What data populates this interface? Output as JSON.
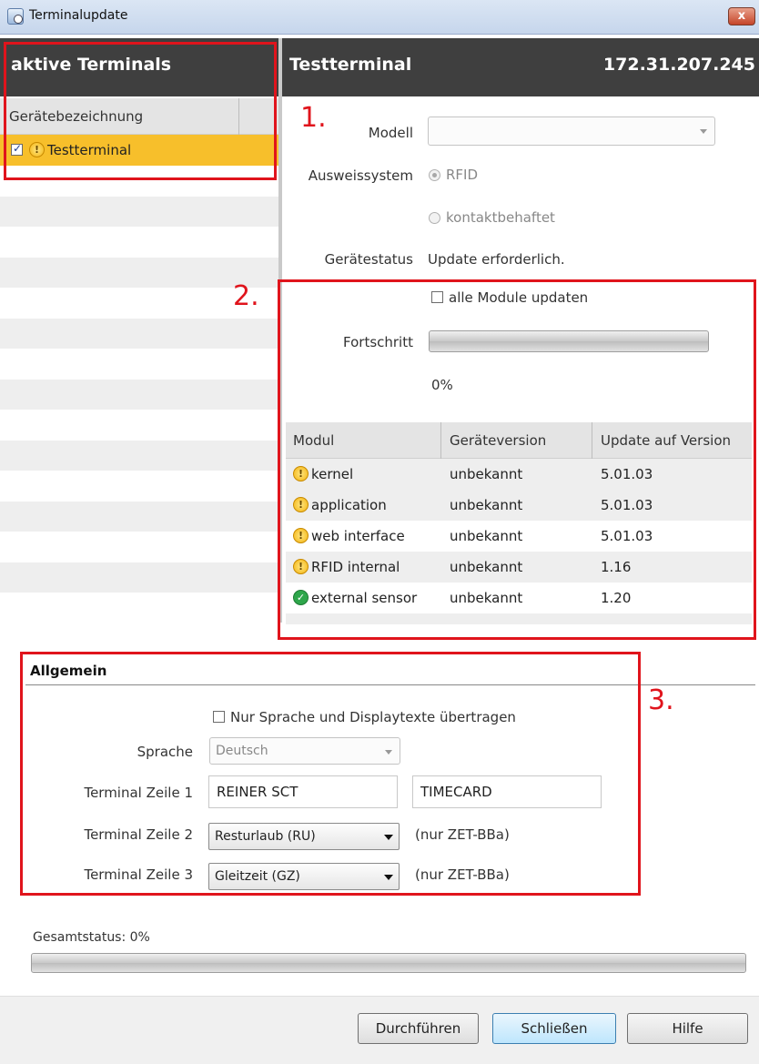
{
  "window": {
    "title": "Terminalupdate",
    "close_label": "x"
  },
  "left_panel": {
    "header": "aktive Terminals",
    "column_header": "Gerätebezeichnung",
    "terminals": [
      {
        "name": "Testterminal",
        "checked": true,
        "status": "warning"
      }
    ]
  },
  "right_panel": {
    "terminal_name": "Testterminal",
    "ip": "172.31.207.245",
    "modell_label": "Modell",
    "modell_value": "",
    "ausweissystem_label": "Ausweissystem",
    "radio_rfid": "RFID",
    "radio_kontakt": "kontaktbehaftet",
    "geraetestatus_label": "Gerätestatus",
    "geraetestatus_value": "Update erforderlich.",
    "alle_module_label": "alle Module updaten",
    "fortschritt_label": "Fortschritt",
    "fortschritt_percent": "0%",
    "fortschritt_value": 0
  },
  "module_table": {
    "headers": [
      "Modul",
      "Geräteversion",
      "Update auf Version"
    ],
    "rows": [
      {
        "status": "warning",
        "modul": "kernel",
        "geraeteversion": "unbekannt",
        "update": "5.01.03"
      },
      {
        "status": "warning",
        "modul": "application",
        "geraeteversion": "unbekannt",
        "update": "5.01.03"
      },
      {
        "status": "warning",
        "modul": "web interface",
        "geraeteversion": "unbekannt",
        "update": "5.01.03"
      },
      {
        "status": "warning",
        "modul": "RFID internal",
        "geraeteversion": "unbekannt",
        "update": "1.16"
      },
      {
        "status": "ok",
        "modul": "external sensor",
        "geraeteversion": "unbekannt",
        "update": "1.20"
      }
    ]
  },
  "allgemein": {
    "title": "Allgemein",
    "nur_sprache_label": "Nur Sprache und Displaytexte übertragen",
    "sprache_label": "Sprache",
    "sprache_value": "Deutsch",
    "zeile1_label": "Terminal Zeile 1",
    "zeile1_value_a": "REINER SCT",
    "zeile1_value_b": "TIMECARD",
    "zeile2_label": "Terminal Zeile 2",
    "zeile2_value": "Resturlaub (RU)",
    "zeile2_note": "(nur ZET-BBa)",
    "zeile3_label": "Terminal Zeile 3",
    "zeile3_value": "Gleitzeit (GZ)",
    "zeile3_note": "(nur ZET-BBa)"
  },
  "gesamtstatus": {
    "label": "Gesamtstatus: 0%",
    "value": 0
  },
  "buttons": {
    "durchfuehren": "Durchführen",
    "schliessen": "Schließen",
    "hilfe": "Hilfe"
  },
  "annotations": [
    "1.",
    "2.",
    "3."
  ],
  "colors": {
    "header_bg": "#3f3f3f",
    "selected_row": "#f7bf2b",
    "annotation_red": "#e0141c"
  }
}
